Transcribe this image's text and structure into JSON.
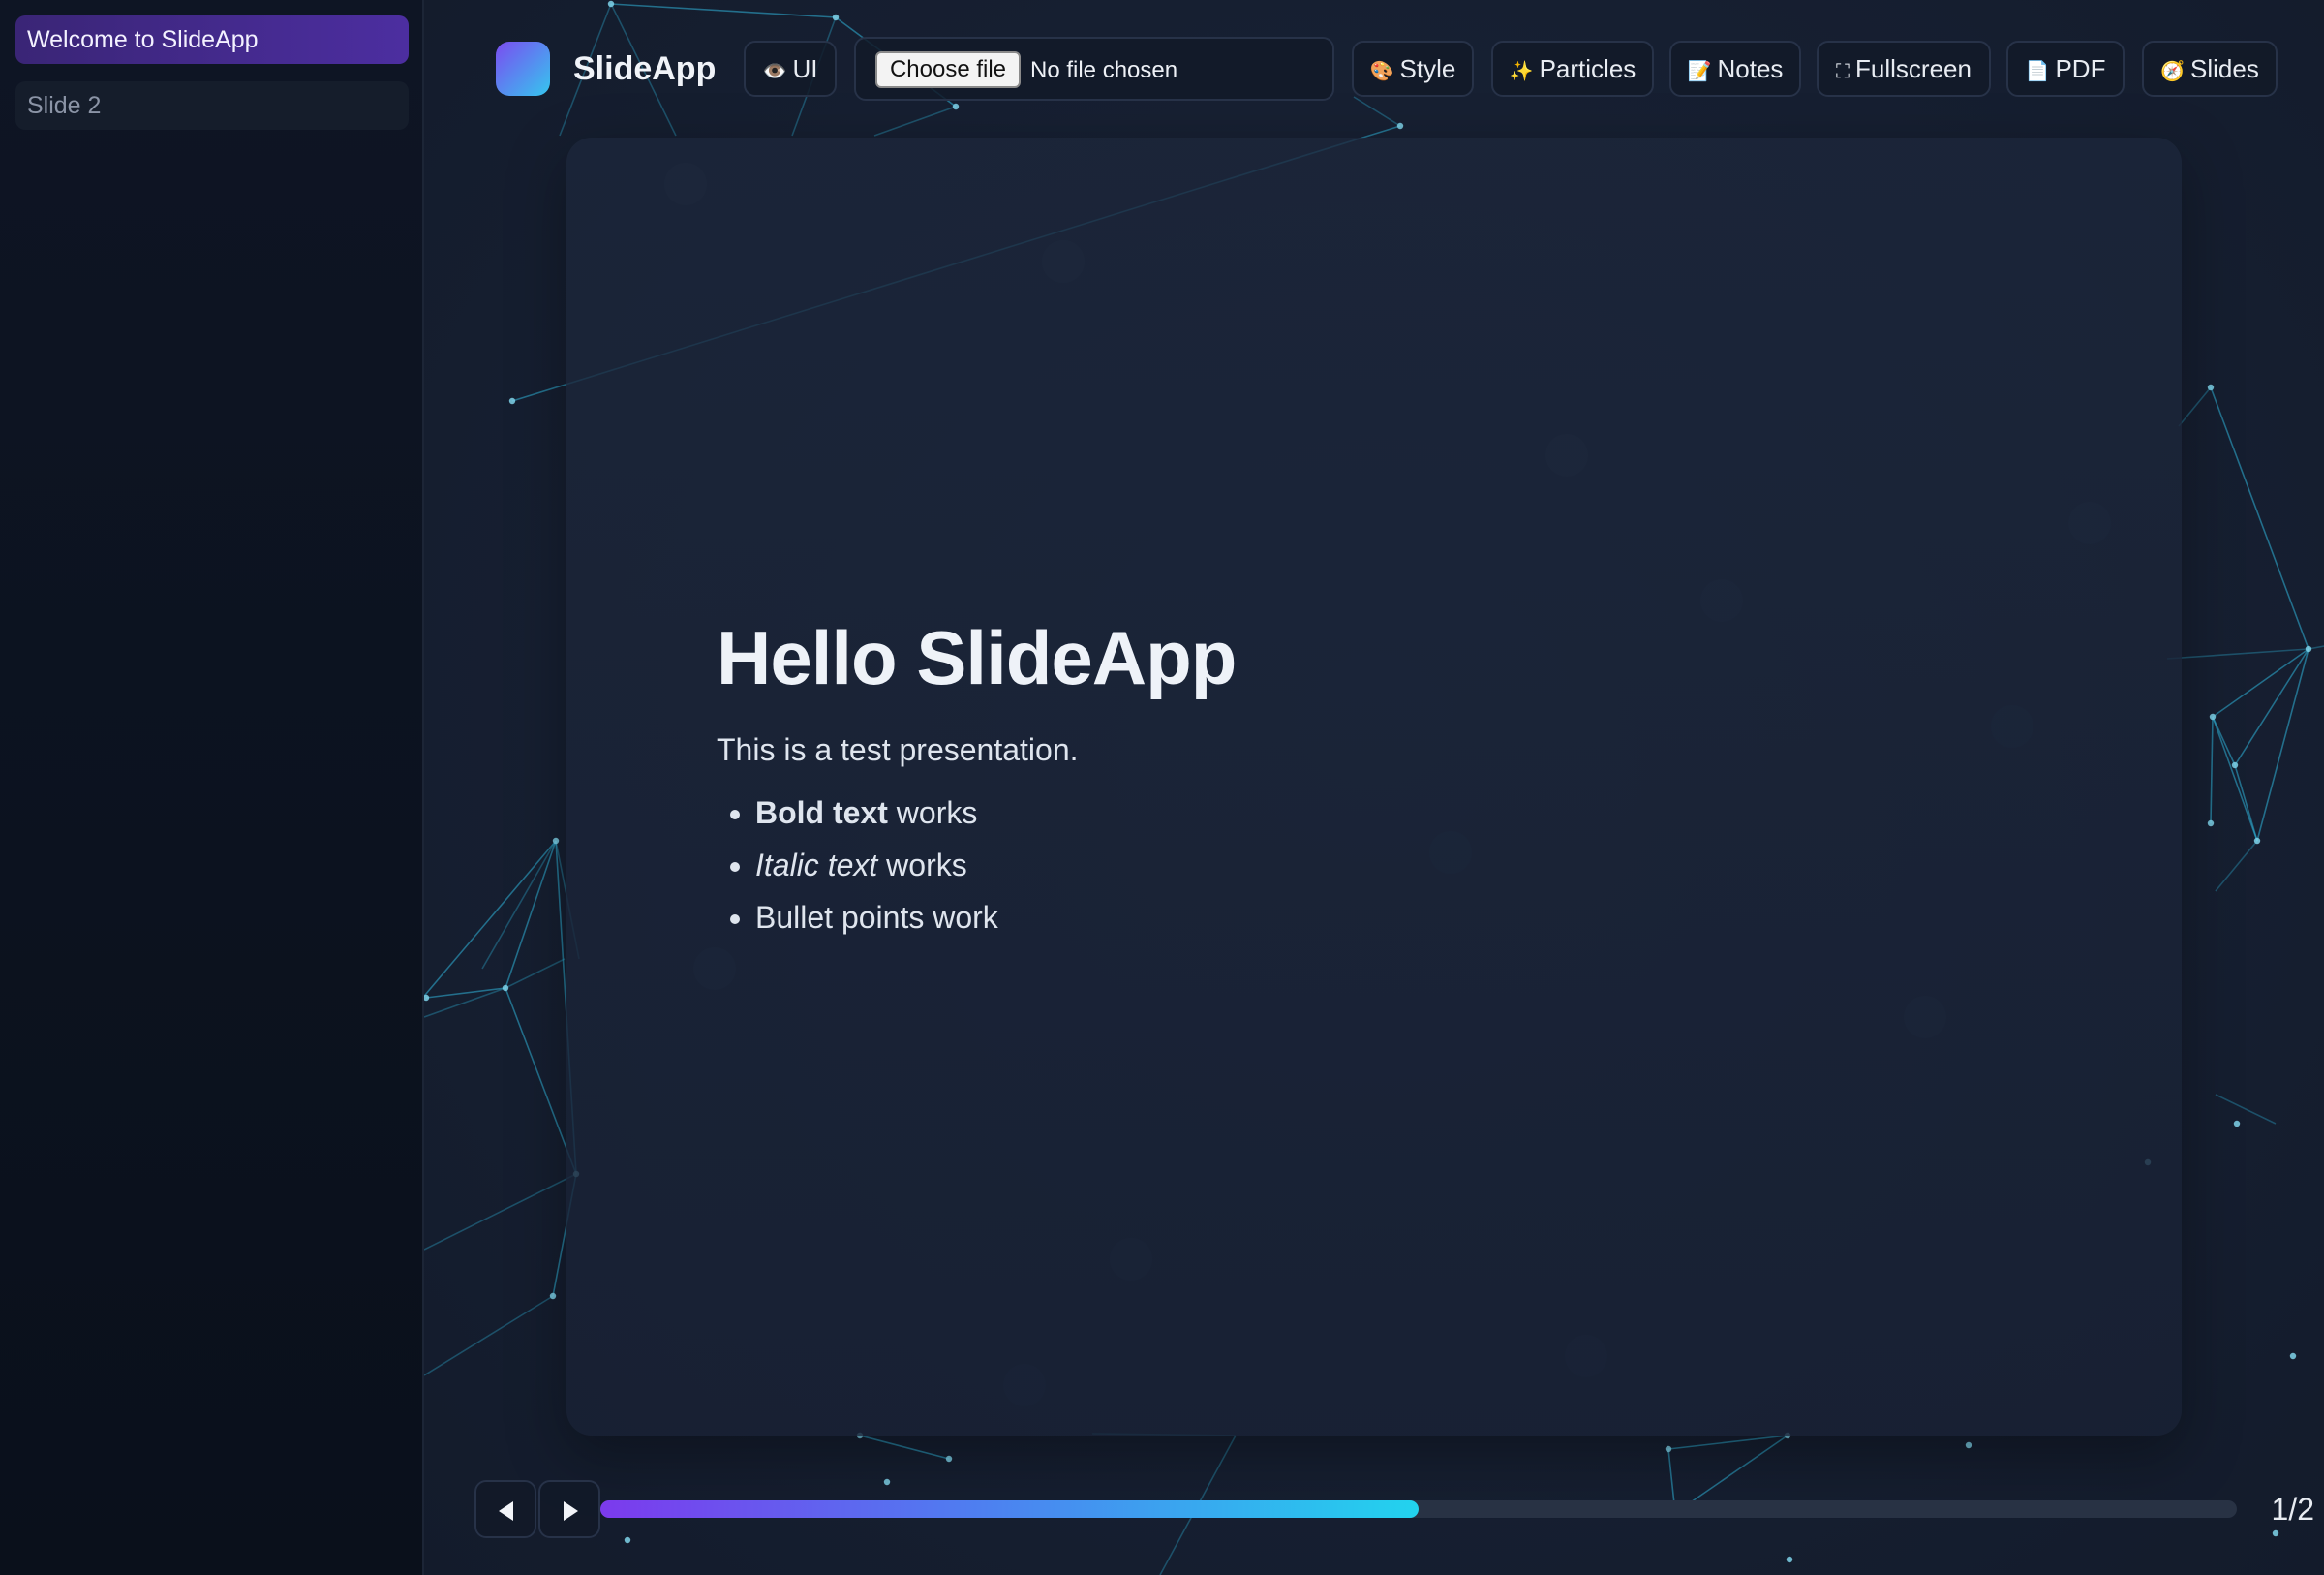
{
  "sidebar": {
    "items": [
      {
        "label": "Welcome to SlideApp",
        "active": true
      },
      {
        "label": "Slide 2",
        "active": false
      }
    ]
  },
  "header": {
    "app_name": "SlideApp",
    "buttons": {
      "ui": {
        "icon": "eye-icon",
        "label": "UI"
      },
      "style": {
        "icon": "palette-icon",
        "label": "Style"
      },
      "particles": {
        "icon": "sparkles-icon",
        "label": "Particles"
      },
      "notes": {
        "icon": "memo-icon",
        "label": "Notes"
      },
      "fullscreen": {
        "icon": "fullscreen-icon",
        "label": "Fullscreen"
      },
      "pdf": {
        "icon": "document-icon",
        "label": "PDF"
      },
      "slides": {
        "icon": "compass-icon",
        "label": "Slides"
      }
    },
    "file_input": {
      "button_label": "Choose file",
      "status": "No file chosen"
    }
  },
  "slide": {
    "title": "Hello SlideApp",
    "paragraph": "This is a test presentation.",
    "bullets": [
      {
        "emphasis": "Bold text",
        "style": "bold",
        "rest": " works"
      },
      {
        "emphasis": "Italic text",
        "style": "italic",
        "rest": " works"
      },
      {
        "text": "Bullet points work"
      }
    ]
  },
  "footer": {
    "progress": 0.5,
    "page_counter": "1/2"
  },
  "colors": {
    "accent_start": "#7c3aed",
    "accent_end": "#22d3ee",
    "active_item": "#4c2ea0",
    "particle": "#2fb3d8"
  }
}
